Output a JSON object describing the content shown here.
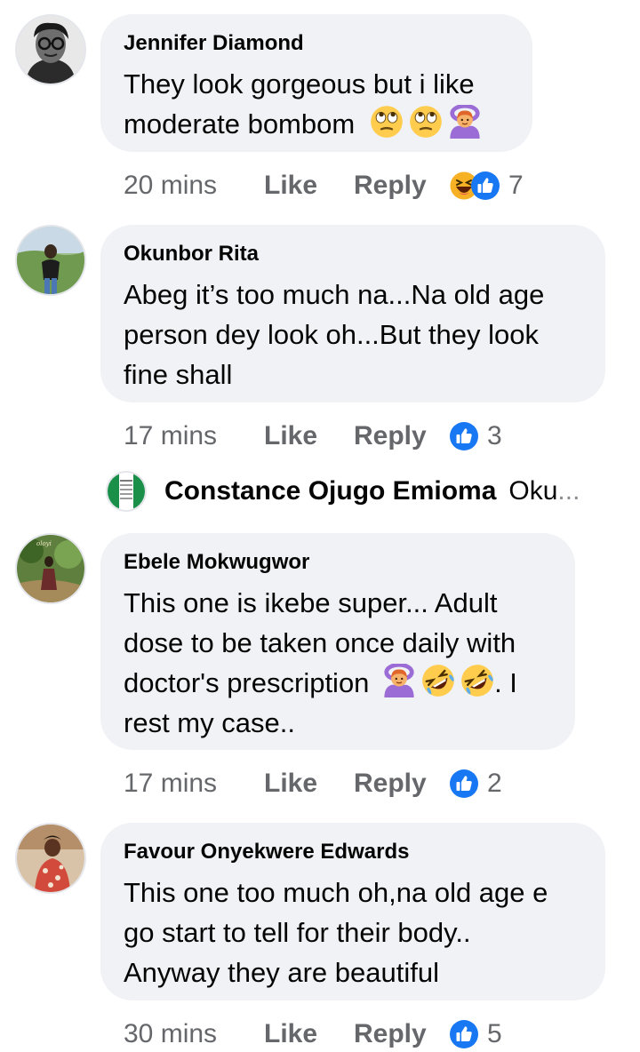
{
  "comments": [
    {
      "name": "Jennifer Diamond",
      "text_lines": [
        "They look gorgeous but i like",
        "moderate bombom"
      ],
      "emojis": [
        "face-with-rolling-eyes",
        "face-with-rolling-eyes",
        "person-gesturing-ok"
      ],
      "time": "20 mins",
      "like_label": "Like",
      "reply_label": "Reply",
      "reactions": [
        "haha",
        "like"
      ],
      "reaction_count": "7"
    },
    {
      "name": "Okunbor Rita",
      "text_lines": [
        "Abeg it’s too much na...Na old age",
        "person dey look oh...But they look",
        "fine shall"
      ],
      "time": "17 mins",
      "like_label": "Like",
      "reply_label": "Reply",
      "reactions": [
        "like"
      ],
      "reaction_count": "3"
    },
    {
      "name": "Ebele Mokwugwor",
      "text_lines": [
        "This one is ikebe super... Adult",
        "dose to be taken once daily with",
        "doctor's prescription",
        ". I",
        "rest my case.."
      ],
      "emojis": [
        "person-gesturing-ok",
        "rolling-on-floor-laughing",
        "rolling-on-floor-laughing"
      ],
      "time": "17 mins",
      "like_label": "Like",
      "reply_label": "Reply",
      "reactions": [
        "like"
      ],
      "reaction_count": "2"
    },
    {
      "name": "Favour Onyekwere Edwards",
      "text_lines": [
        "This one too much oh,na old age e",
        "go start to tell for their body..",
        "Anyway they are beautiful"
      ],
      "time": "30 mins",
      "like_label": "Like",
      "reply_label": "Reply",
      "reactions": [
        "like"
      ],
      "reaction_count": "5"
    }
  ],
  "reply_preview": {
    "name": "Constance Ojugo Emioma",
    "preview": "Oku",
    "ellipsis": "..."
  },
  "colors": {
    "bubble": "#f0f2f5",
    "meta_text": "#65676b",
    "like_blue": "#1877f2",
    "haha_yellow": "#f7b125"
  }
}
